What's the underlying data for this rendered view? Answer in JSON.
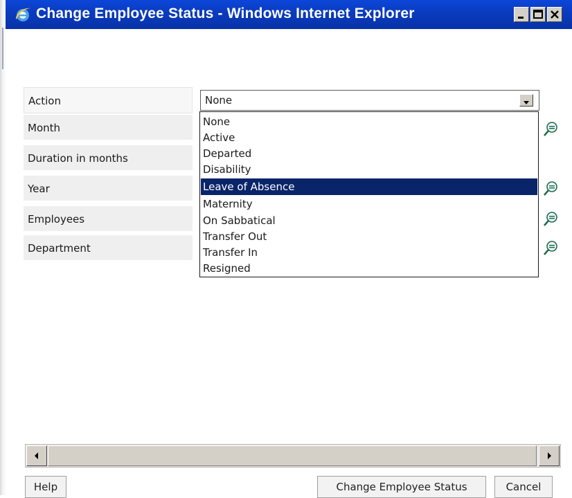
{
  "window": {
    "title": "Change Employee Status - Windows Internet Explorer",
    "icon": "internet-explorer-icon",
    "controls": [
      "minimize-icon",
      "maximize-icon",
      "close-icon"
    ]
  },
  "form": {
    "fields": [
      {
        "label": "Action"
      },
      {
        "label": "Month"
      },
      {
        "label": "Duration in months"
      },
      {
        "label": "Year"
      },
      {
        "label": "Employees"
      },
      {
        "label": "Department"
      }
    ],
    "action_select": {
      "value": "None",
      "options": [
        "None",
        "Active",
        "Departed",
        "Disability",
        "Leave of Absence",
        "Maternity",
        "On Sabbatical",
        "Transfer Out",
        "Transfer In",
        "Resigned"
      ],
      "highlighted": "Leave of Absence"
    }
  },
  "footer": {
    "help_label": "Help",
    "submit_label": "Change Employee Status",
    "cancel_label": "Cancel"
  },
  "colors": {
    "titlebar": "#0a3cc0",
    "selection": "#0a246a",
    "label_bg": "#efefef"
  }
}
